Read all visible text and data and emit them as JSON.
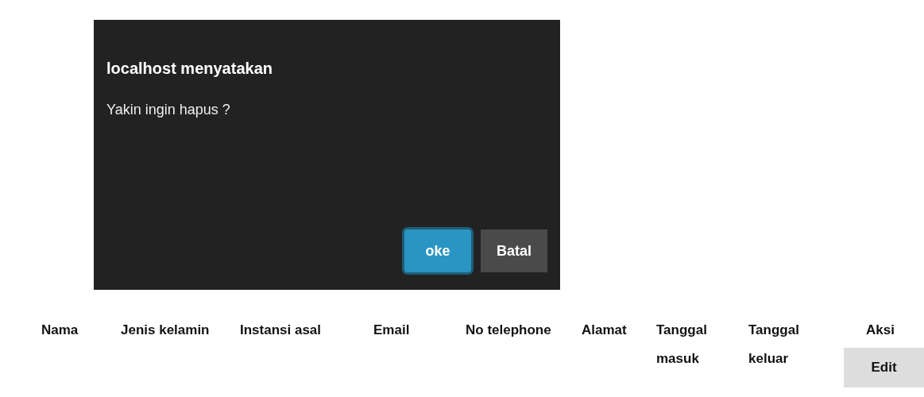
{
  "dialog": {
    "title": "localhost menyatakan",
    "message": "Yakin ingin hapus ?",
    "buttons": [
      {
        "label": "oke",
        "kind": "primary",
        "focused": true
      },
      {
        "label": "Batal",
        "kind": "secondary",
        "focused": false
      }
    ]
  },
  "table": {
    "columns": [
      "Nama",
      "Jenis kelamin",
      "Instansi asal",
      "Email",
      "No telephone",
      "Alamat",
      "Tanggal masuk",
      "Tanggal keluar",
      "Aksi"
    ],
    "action_button": "Edit"
  }
}
